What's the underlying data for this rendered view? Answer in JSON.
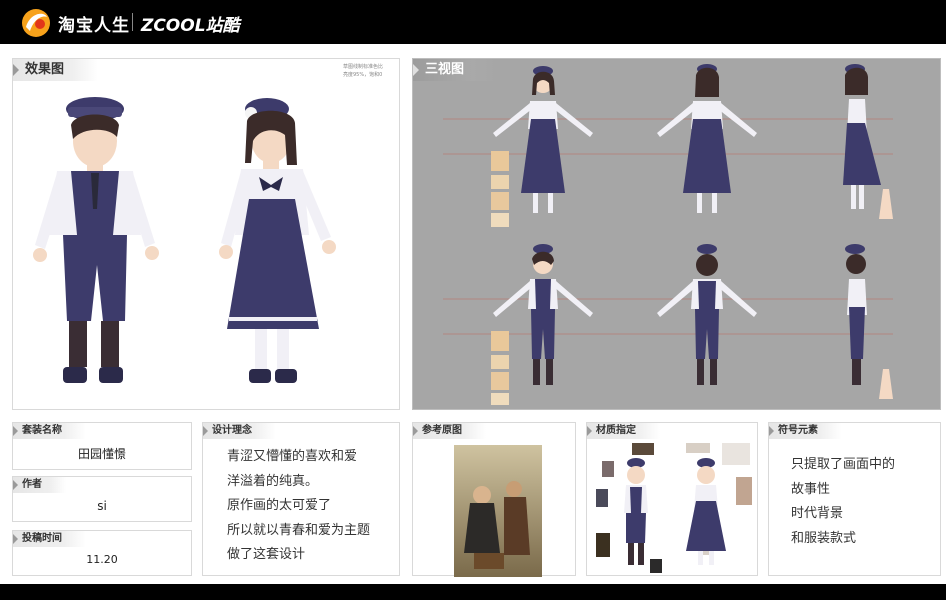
{
  "header": {
    "brand_taobao": "淘宝人生",
    "brand_zcool": "ZCOOL站酷"
  },
  "panels": {
    "effect": {
      "title": "效果图",
      "note_line1": "草图线制标准色比",
      "note_line2": "亮度95%，饱和0"
    },
    "three_view": {
      "title": "三视图"
    },
    "outfit_name": {
      "title": "套装名称",
      "value": "田园懂憬"
    },
    "author": {
      "title": "作者",
      "value": "si"
    },
    "submit_time": {
      "title": "投稿时间",
      "value": "11.20"
    },
    "design_concept": {
      "title": "设计理念",
      "lines": [
        "青涩又懵懂的喜欢和爱",
        "洋溢着的纯真。",
        "原作画的太可爱了",
        "所以就以青春和爱为主题",
        "做了这套设计"
      ]
    },
    "reference": {
      "title": "参考原图"
    },
    "material": {
      "title": "材质指定"
    },
    "symbol": {
      "title": "符号元素",
      "lines": [
        "只提取了画面中的",
        "故事性",
        "时代背景",
        "和服装款式"
      ]
    }
  },
  "colors": {
    "top_bar": "#000000",
    "outfit_navy": "#3d3b6b",
    "shirt_white": "#f1f0f6",
    "hair_brown": "#3b2b29",
    "three_view_bg": "#a6a6a6"
  }
}
